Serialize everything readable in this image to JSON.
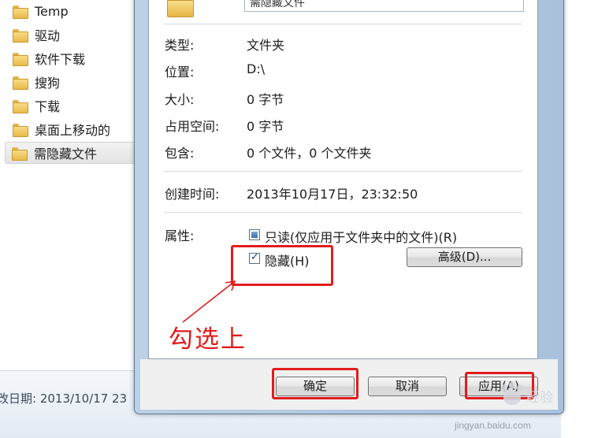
{
  "explorer": {
    "folders": [
      {
        "label": "Temp",
        "selected": false
      },
      {
        "label": "驱动",
        "selected": false
      },
      {
        "label": "软件下载",
        "selected": false
      },
      {
        "label": "搜狗",
        "selected": false
      },
      {
        "label": "下载",
        "selected": false
      },
      {
        "label": "桌面上移动的",
        "selected": false
      },
      {
        "label": "需隐藏文件",
        "selected": true
      }
    ],
    "details_date": "改日期: 2013/10/17 23"
  },
  "dialog": {
    "folder_name": "需隐藏文件",
    "props": {
      "type_label": "类型:",
      "type_value": "文件夹",
      "location_label": "位置:",
      "location_value": "D:\\",
      "size_label": "大小:",
      "size_value": "0 字节",
      "size_on_disk_label": "占用空间:",
      "size_on_disk_value": "0 字节",
      "contains_label": "包含:",
      "contains_value": "0 个文件，0 个文件夹",
      "created_label": "创建时间:",
      "created_value": "2013年10月17日，23:32:50",
      "attributes_label": "属性:"
    },
    "attributes": {
      "readonly_label": "只读(仅应用于文件夹中的文件)(R)",
      "readonly_state": "indeterminate",
      "hidden_label": "隐藏(H)",
      "hidden_state": "checked",
      "advanced_button": "高级(D)..."
    },
    "buttons": {
      "ok": "确定",
      "cancel": "取消",
      "apply": "应用(A)"
    }
  },
  "annotation": {
    "text": "勾选上",
    "color": "#e21c1c"
  },
  "watermark": {
    "logo": "Baidu经验",
    "url": "jingyan.baidu.com"
  }
}
